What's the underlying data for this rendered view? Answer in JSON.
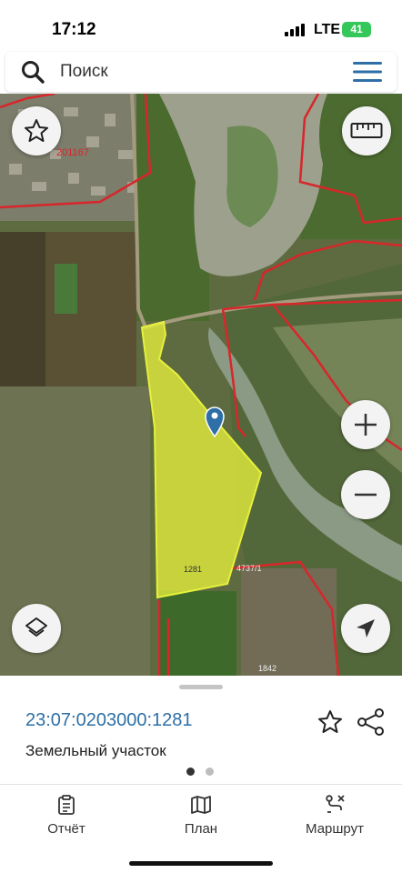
{
  "status_bar": {
    "time": "17:12",
    "network": "LTE",
    "battery": "41"
  },
  "search": {
    "placeholder": "Поиск",
    "icon": "search-icon",
    "menu_icon": "hamburger-menu-icon"
  },
  "map": {
    "labels": {
      "parcel_201167": "201167",
      "parcel_1281": "1281",
      "parcel_4737": "4737/1",
      "parcel_1842": "1842"
    },
    "colors": {
      "boundary": "#d8262b",
      "selected_parcel": "#e6f03c",
      "pin": "#2d6fa6"
    },
    "buttons": {
      "favorite": "star-icon",
      "ruler": "ruler-icon",
      "zoom_in": "plus-icon",
      "zoom_out": "minus-icon",
      "layers": "layers-icon",
      "location": "navigation-arrow-icon"
    }
  },
  "sheet": {
    "cadastral_number": "23:07:0203000:1281",
    "parcel_type": "Земельный участок",
    "page_count": 2,
    "current_page": 1
  },
  "tabs": [
    {
      "label": "Отчёт",
      "icon": "report-icon"
    },
    {
      "label": "План",
      "icon": "map-plan-icon"
    },
    {
      "label": "Маршрут",
      "icon": "route-icon"
    }
  ]
}
